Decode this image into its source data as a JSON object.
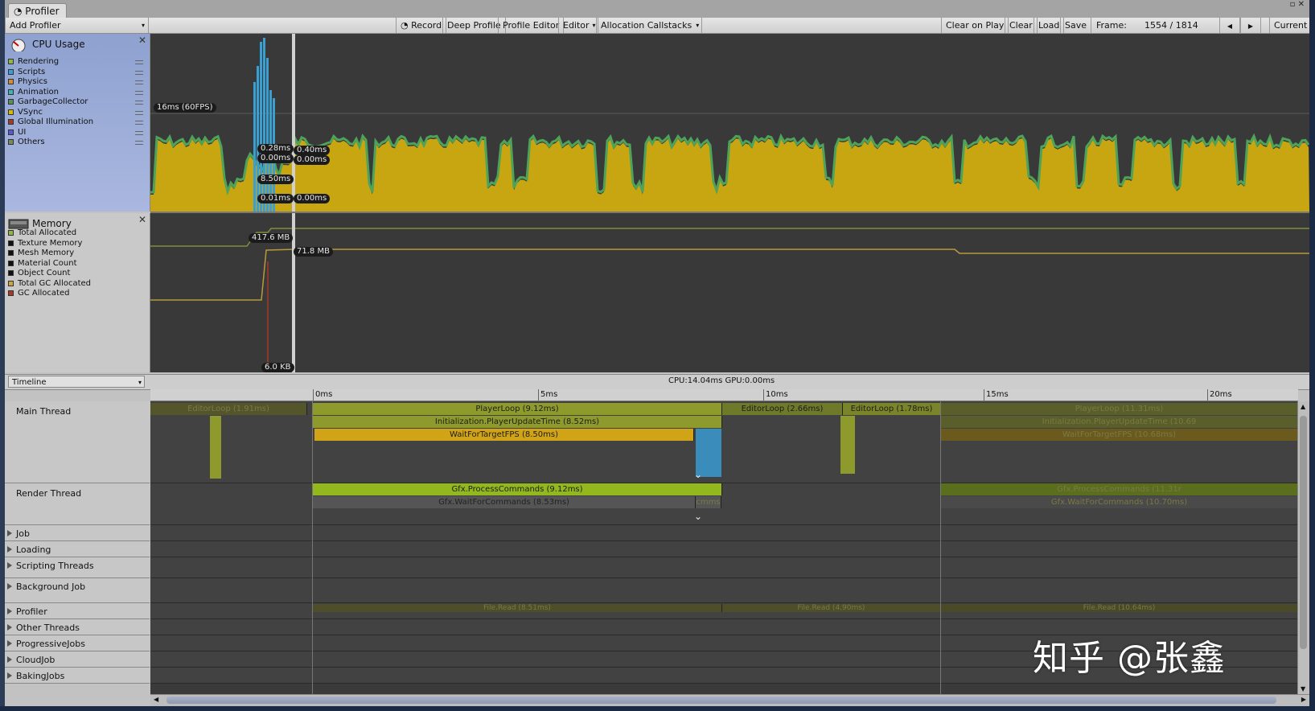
{
  "window": {
    "tab_title": "Profiler",
    "controls": "▫ ✕"
  },
  "toolbar": {
    "add_profiler": "Add Profiler",
    "record": "Record",
    "deep_profile": "Deep Profile",
    "profile_editor": "Profile Editor",
    "editor": "Editor",
    "allocation_callstacks": "Allocation Callstacks",
    "clear_on_play": "Clear on Play",
    "clear": "Clear",
    "load": "Load",
    "save": "Save",
    "frame_label": "Frame:",
    "frame_value": "1554 / 1814",
    "current": "Current",
    "prev": "◀",
    "next": "▶"
  },
  "cpu": {
    "title": "CPU Usage",
    "close": "✕",
    "legend": [
      {
        "label": "Rendering",
        "color": "#8fb840"
      },
      {
        "label": "Scripts",
        "color": "#3b9fd1"
      },
      {
        "label": "Physics",
        "color": "#d68c2a"
      },
      {
        "label": "Animation",
        "color": "#3fb3b3"
      },
      {
        "label": "GarbageCollector",
        "color": "#5a8f5a"
      },
      {
        "label": "VSync",
        "color": "#d8b800"
      },
      {
        "label": "Global Illumination",
        "color": "#a63a26"
      },
      {
        "label": "UI",
        "color": "#5a5ad0"
      },
      {
        "label": "Others",
        "color": "#7a8a5a"
      }
    ],
    "fps_line": "16ms (60FPS)",
    "tags_left": [
      "0.28ms",
      "0.00ms",
      "8.50ms",
      "0.01ms"
    ],
    "tags_right": [
      "0.40ms",
      "0.00ms",
      "0.00ms"
    ]
  },
  "memory": {
    "title": "Memory",
    "close": "✕",
    "legend": [
      {
        "label": "Total Allocated",
        "color": "#8fb840"
      },
      {
        "label": "Texture Memory",
        "color": "#111111"
      },
      {
        "label": "Mesh Memory",
        "color": "#111111"
      },
      {
        "label": "Material Count",
        "color": "#111111"
      },
      {
        "label": "Object Count",
        "color": "#111111"
      },
      {
        "label": "Total GC Allocated",
        "color": "#c9a640"
      },
      {
        "label": "GC Allocated",
        "color": "#a63a26"
      }
    ],
    "tag_total": "417.6 MB",
    "tag_gc": "71.8 MB",
    "tag_bottom": "6.0 KB"
  },
  "timeline": {
    "dropdown": "Timeline",
    "cpu_gpu": "CPU:14.04ms   GPU:0.00ms",
    "ruler": [
      "0ms",
      "5ms",
      "10ms",
      "15ms",
      "20ms"
    ],
    "threads": [
      {
        "label": "Main Thread",
        "expandable": false
      },
      {
        "label": "Render Thread",
        "expandable": false
      },
      {
        "label": "Job",
        "expandable": true
      },
      {
        "label": "Loading",
        "expandable": true
      },
      {
        "label": "Scripting Threads",
        "expandable": true
      },
      {
        "label": "Background Job",
        "expandable": true
      },
      {
        "label": "Profiler",
        "expandable": true
      },
      {
        "label": "Other Threads",
        "expandable": true
      },
      {
        "label": "ProgressiveJobs",
        "expandable": true
      },
      {
        "label": "CloudJob",
        "expandable": true
      },
      {
        "label": "BakingJobs",
        "expandable": true
      }
    ],
    "main_bars": {
      "editor_loop_prev": "EditorLoop (1.91ms)",
      "player_loop": "PlayerLoop (9.12ms)",
      "player_update": "Initialization.PlayerUpdateTime (8.52ms)",
      "wait_fps": "WaitForTargetFPS (8.50ms)",
      "editor_loop_a": "EditorLoop (2.66ms)",
      "editor_loop_b": "EditorLoop (1.78ms)",
      "player_loop_next": "PlayerLoop (11.31ms)",
      "player_update_next": "Initialization.PlayerUpdateTime (10.69",
      "wait_fps_next": "WaitForTargetFPS (10.68ms)"
    },
    "render_bars": {
      "process_cmds": "Gfx.ProcessCommands (9.12ms)",
      "wait_cmds": "Gfx.WaitForCommands (8.53ms)",
      "process_cmds_next": "Gfx.ProcessCommands (11.31r",
      "wait_cmds_next": "Gfx.WaitForCommands (10.70ms)",
      "small_tag": "cmms"
    },
    "profiler_bars": {
      "file_read_a": "File.Read (8.51ms)",
      "file_read_b": "File.Read (4.90ms)",
      "file_read_c": "File.Read (10.64ms)"
    }
  },
  "watermark": "知乎 @张鑫"
}
